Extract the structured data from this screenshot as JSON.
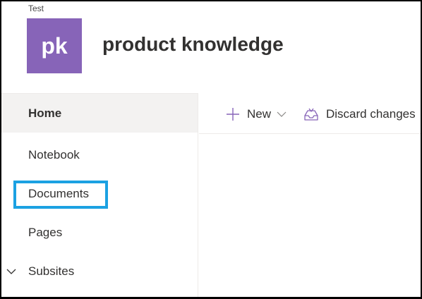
{
  "header": {
    "breadcrumb": "Test",
    "logo_initials": "pk",
    "logo_color": "#8764b8",
    "site_title": "product knowledge"
  },
  "left_nav": {
    "items": [
      {
        "label": "Home",
        "selected": true
      },
      {
        "label": "Notebook",
        "selected": false
      },
      {
        "label": "Documents",
        "selected": false,
        "highlighted": true
      },
      {
        "label": "Pages",
        "selected": false
      },
      {
        "label": "Subsites",
        "selected": false,
        "expandable": true,
        "icon": "chevron-down-icon"
      }
    ],
    "highlight_color": "#1ba1e2"
  },
  "command_bar": {
    "new_label": "New",
    "new_icon": "plus-icon",
    "new_dropdown_icon": "chevron-down-icon",
    "discard_label": "Discard changes",
    "discard_icon": "discard-icon",
    "accent_color": "#8764b8"
  }
}
